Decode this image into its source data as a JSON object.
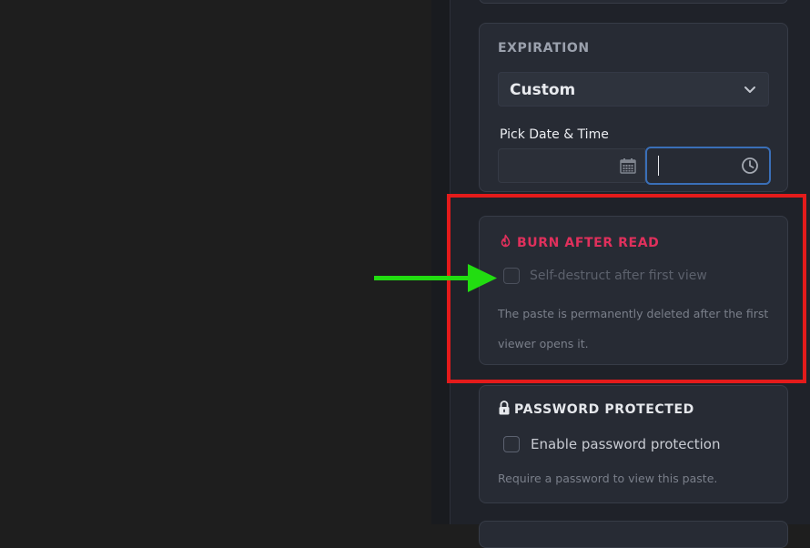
{
  "expiration": {
    "title": "EXPIRATION",
    "select_value": "Custom",
    "pick_label": "Pick Date & Time",
    "date_value": "",
    "time_value": ""
  },
  "burn": {
    "title": "BURN AFTER READ",
    "checkbox_label": "Self-destruct after first view",
    "checked": false,
    "help": "The paste is permanently deleted after the first viewer opens it."
  },
  "password": {
    "title": "PASSWORD PROTECTED",
    "checkbox_label": "Enable password protection",
    "checked": false,
    "help": "Require a password to view this paste."
  },
  "colors": {
    "accent_burn": "#e0305c",
    "focus_border": "#3a6fb8",
    "highlight_red": "#e41b1b",
    "arrow_green": "#22dd11"
  },
  "icons": [
    "chevron-down-icon",
    "calendar-icon",
    "clock-icon",
    "fire-icon",
    "lock-icon"
  ]
}
